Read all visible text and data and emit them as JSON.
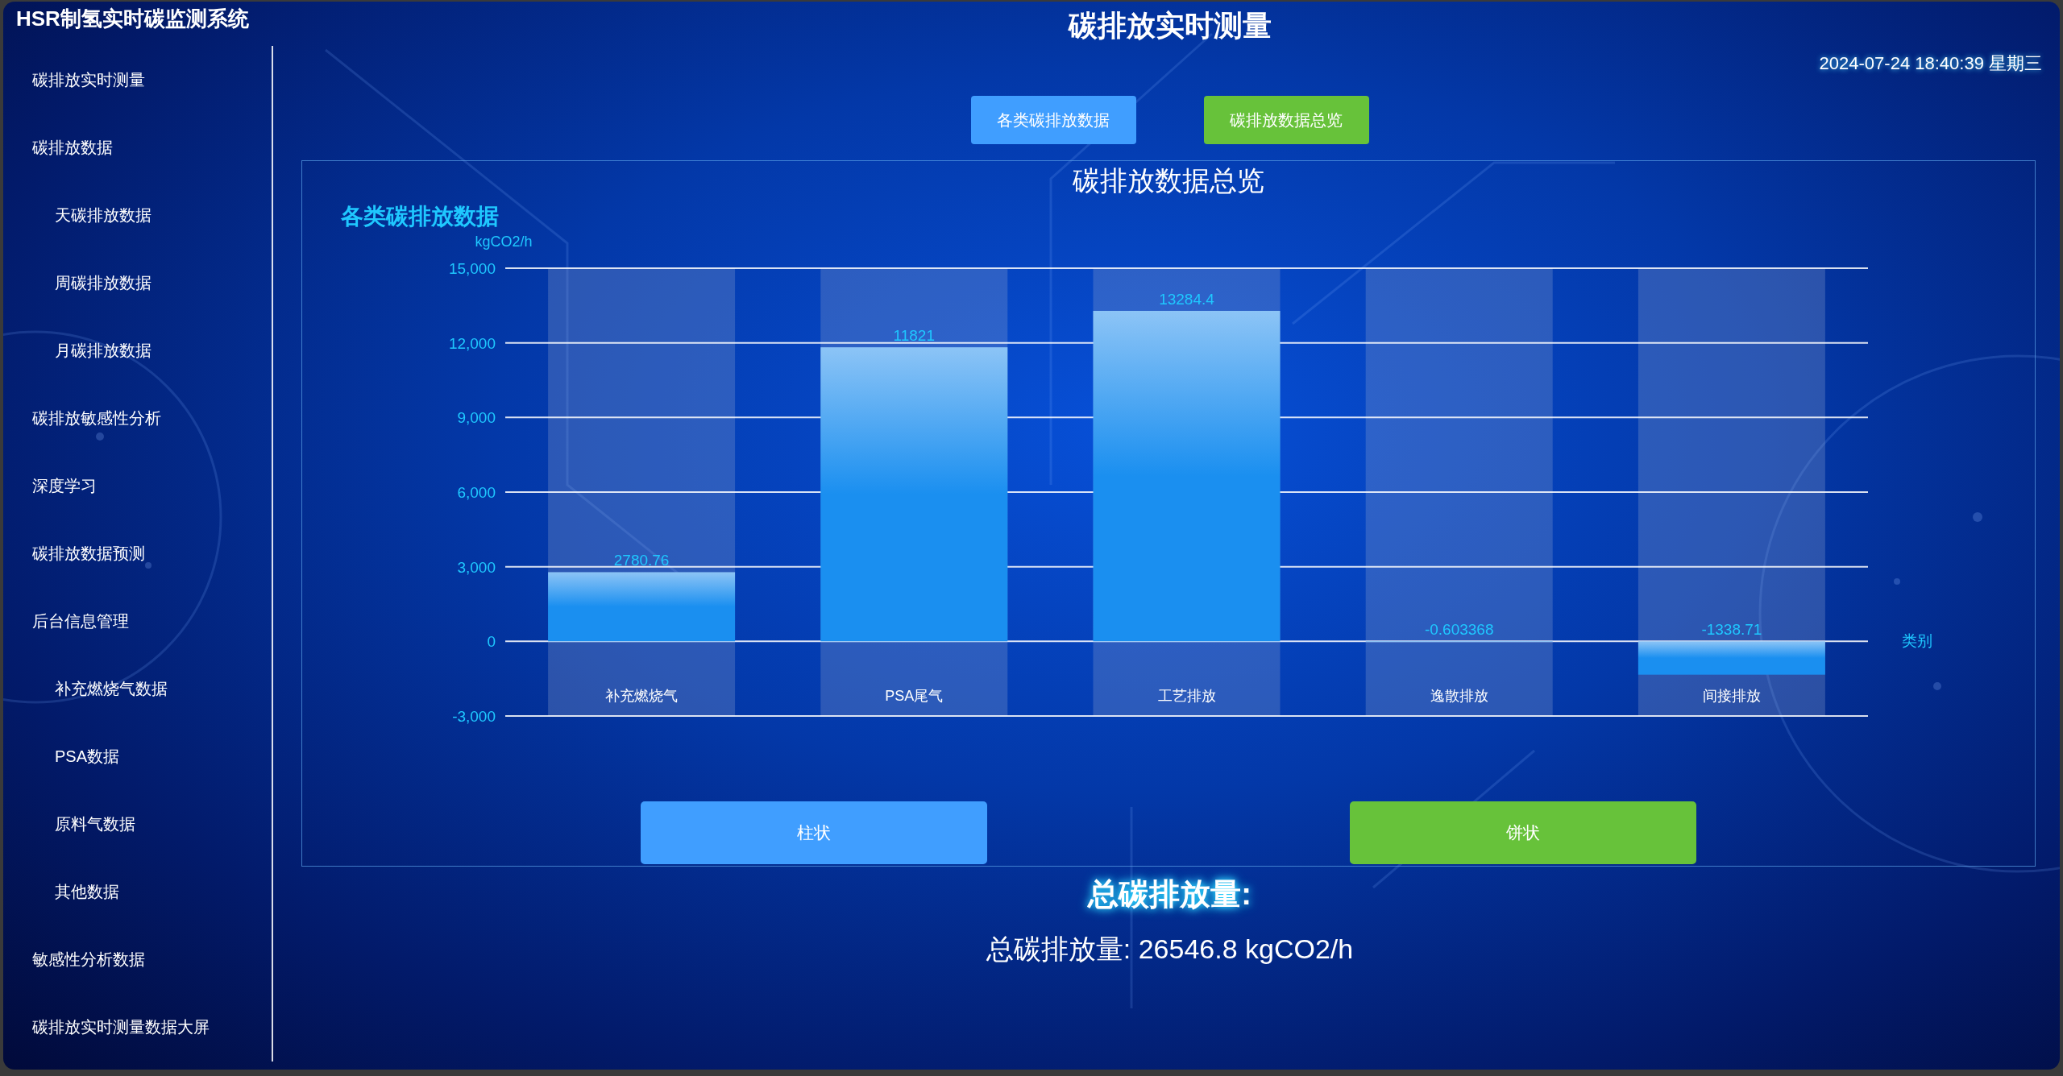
{
  "app": {
    "title": "HSR制氢实时碳监测系统"
  },
  "sidebar": {
    "items": [
      {
        "label": "碳排放实时测量"
      },
      {
        "label": "碳排放数据",
        "children": [
          {
            "label": "天碳排放数据"
          },
          {
            "label": "周碳排放数据"
          },
          {
            "label": "月碳排放数据"
          }
        ]
      },
      {
        "label": "碳排放敏感性分析"
      },
      {
        "label": "深度学习"
      },
      {
        "label": "碳排放数据预测"
      },
      {
        "label": "后台信息管理",
        "children": [
          {
            "label": "补充燃烧气数据"
          },
          {
            "label": "PSA数据"
          },
          {
            "label": "原料气数据"
          },
          {
            "label": "其他数据"
          }
        ]
      },
      {
        "label": "敏感性分析数据"
      },
      {
        "label": "碳排放实时测量数据大屏"
      }
    ]
  },
  "header": {
    "title": "碳排放实时测量",
    "datetime": "2024-07-24 18:40:39 星期三"
  },
  "tabs": [
    {
      "label": "各类碳排放数据",
      "color": "#409eff"
    },
    {
      "label": "碳排放数据总览",
      "color": "#67c23a"
    }
  ],
  "panel": {
    "title": "碳排放数据总览",
    "chart_data": {
      "type": "bar",
      "title": "各类碳排放数据",
      "ylabel": "kgCO2/h",
      "xlabel": "类别",
      "categories": [
        "补充燃烧气",
        "PSA尾气",
        "工艺排放",
        "逸散排放",
        "间接排放"
      ],
      "values": [
        2780.76,
        11821,
        13284.4,
        -0.603368,
        -1338.71
      ],
      "ylim": [
        -3000,
        15000
      ],
      "yticks": [
        {
          "value": -3000,
          "label": "-3,000"
        },
        {
          "value": 0,
          "label": "0"
        },
        {
          "value": 3000,
          "label": "3,000"
        },
        {
          "value": 6000,
          "label": "6,000"
        },
        {
          "value": 9000,
          "label": "9,000"
        },
        {
          "value": 12000,
          "label": "12,000"
        },
        {
          "value": 15000,
          "label": "15,000"
        }
      ],
      "data_labels": true,
      "grid": true
    },
    "buttons": [
      {
        "label": "柱状",
        "color": "#409eff"
      },
      {
        "label": "饼状",
        "color": "#67c23a"
      }
    ]
  },
  "total": {
    "heading": "总碳排放量:",
    "text": "总碳排放量: 26546.8 kgCO2/h"
  }
}
